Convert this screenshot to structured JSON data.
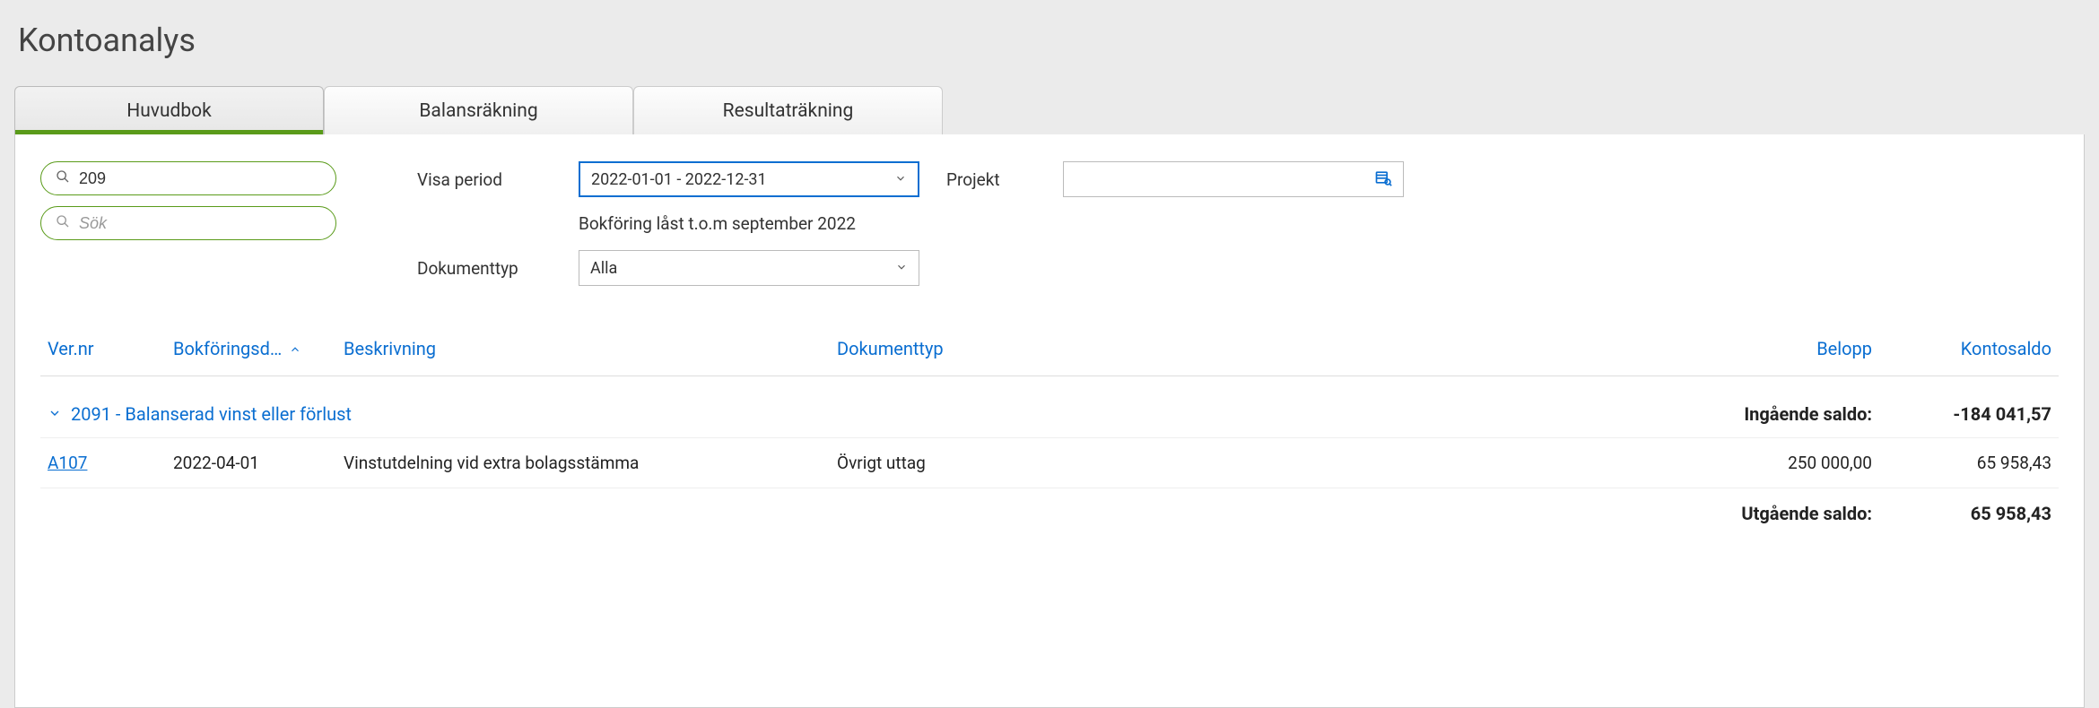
{
  "page": {
    "title": "Kontoanalys"
  },
  "tabs": {
    "huvudbok": "Huvudbok",
    "balans": "Balansräkning",
    "resultat": "Resultaträkning"
  },
  "filters": {
    "search1_value": "209",
    "search2_placeholder": "Sök",
    "period_label": "Visa period",
    "period_value": "2022-01-01 - 2022-12-31",
    "locked_note": "Bokföring låst t.o.m september 2022",
    "doctype_label": "Dokumenttyp",
    "doctype_value": "Alla",
    "project_label": "Projekt",
    "project_value": ""
  },
  "table": {
    "headers": {
      "ver": "Ver.nr",
      "date": "Bokföringsd…",
      "desc": "Beskrivning",
      "doctype": "Dokumenttyp",
      "amount": "Belopp",
      "balance": "Kontosaldo"
    },
    "group": {
      "title": "2091 - Balanserad vinst eller förlust",
      "in_label": "Ingående saldo:",
      "in_value": "-184 041,57",
      "out_label": "Utgående saldo:",
      "out_value": "65 958,43"
    },
    "rows": [
      {
        "ver": "A107",
        "date": "2022-04-01",
        "desc": "Vinstutdelning vid extra bolagsstämma",
        "doctype": "Övrigt uttag",
        "amount": "250 000,00",
        "balance": "65 958,43"
      }
    ]
  }
}
